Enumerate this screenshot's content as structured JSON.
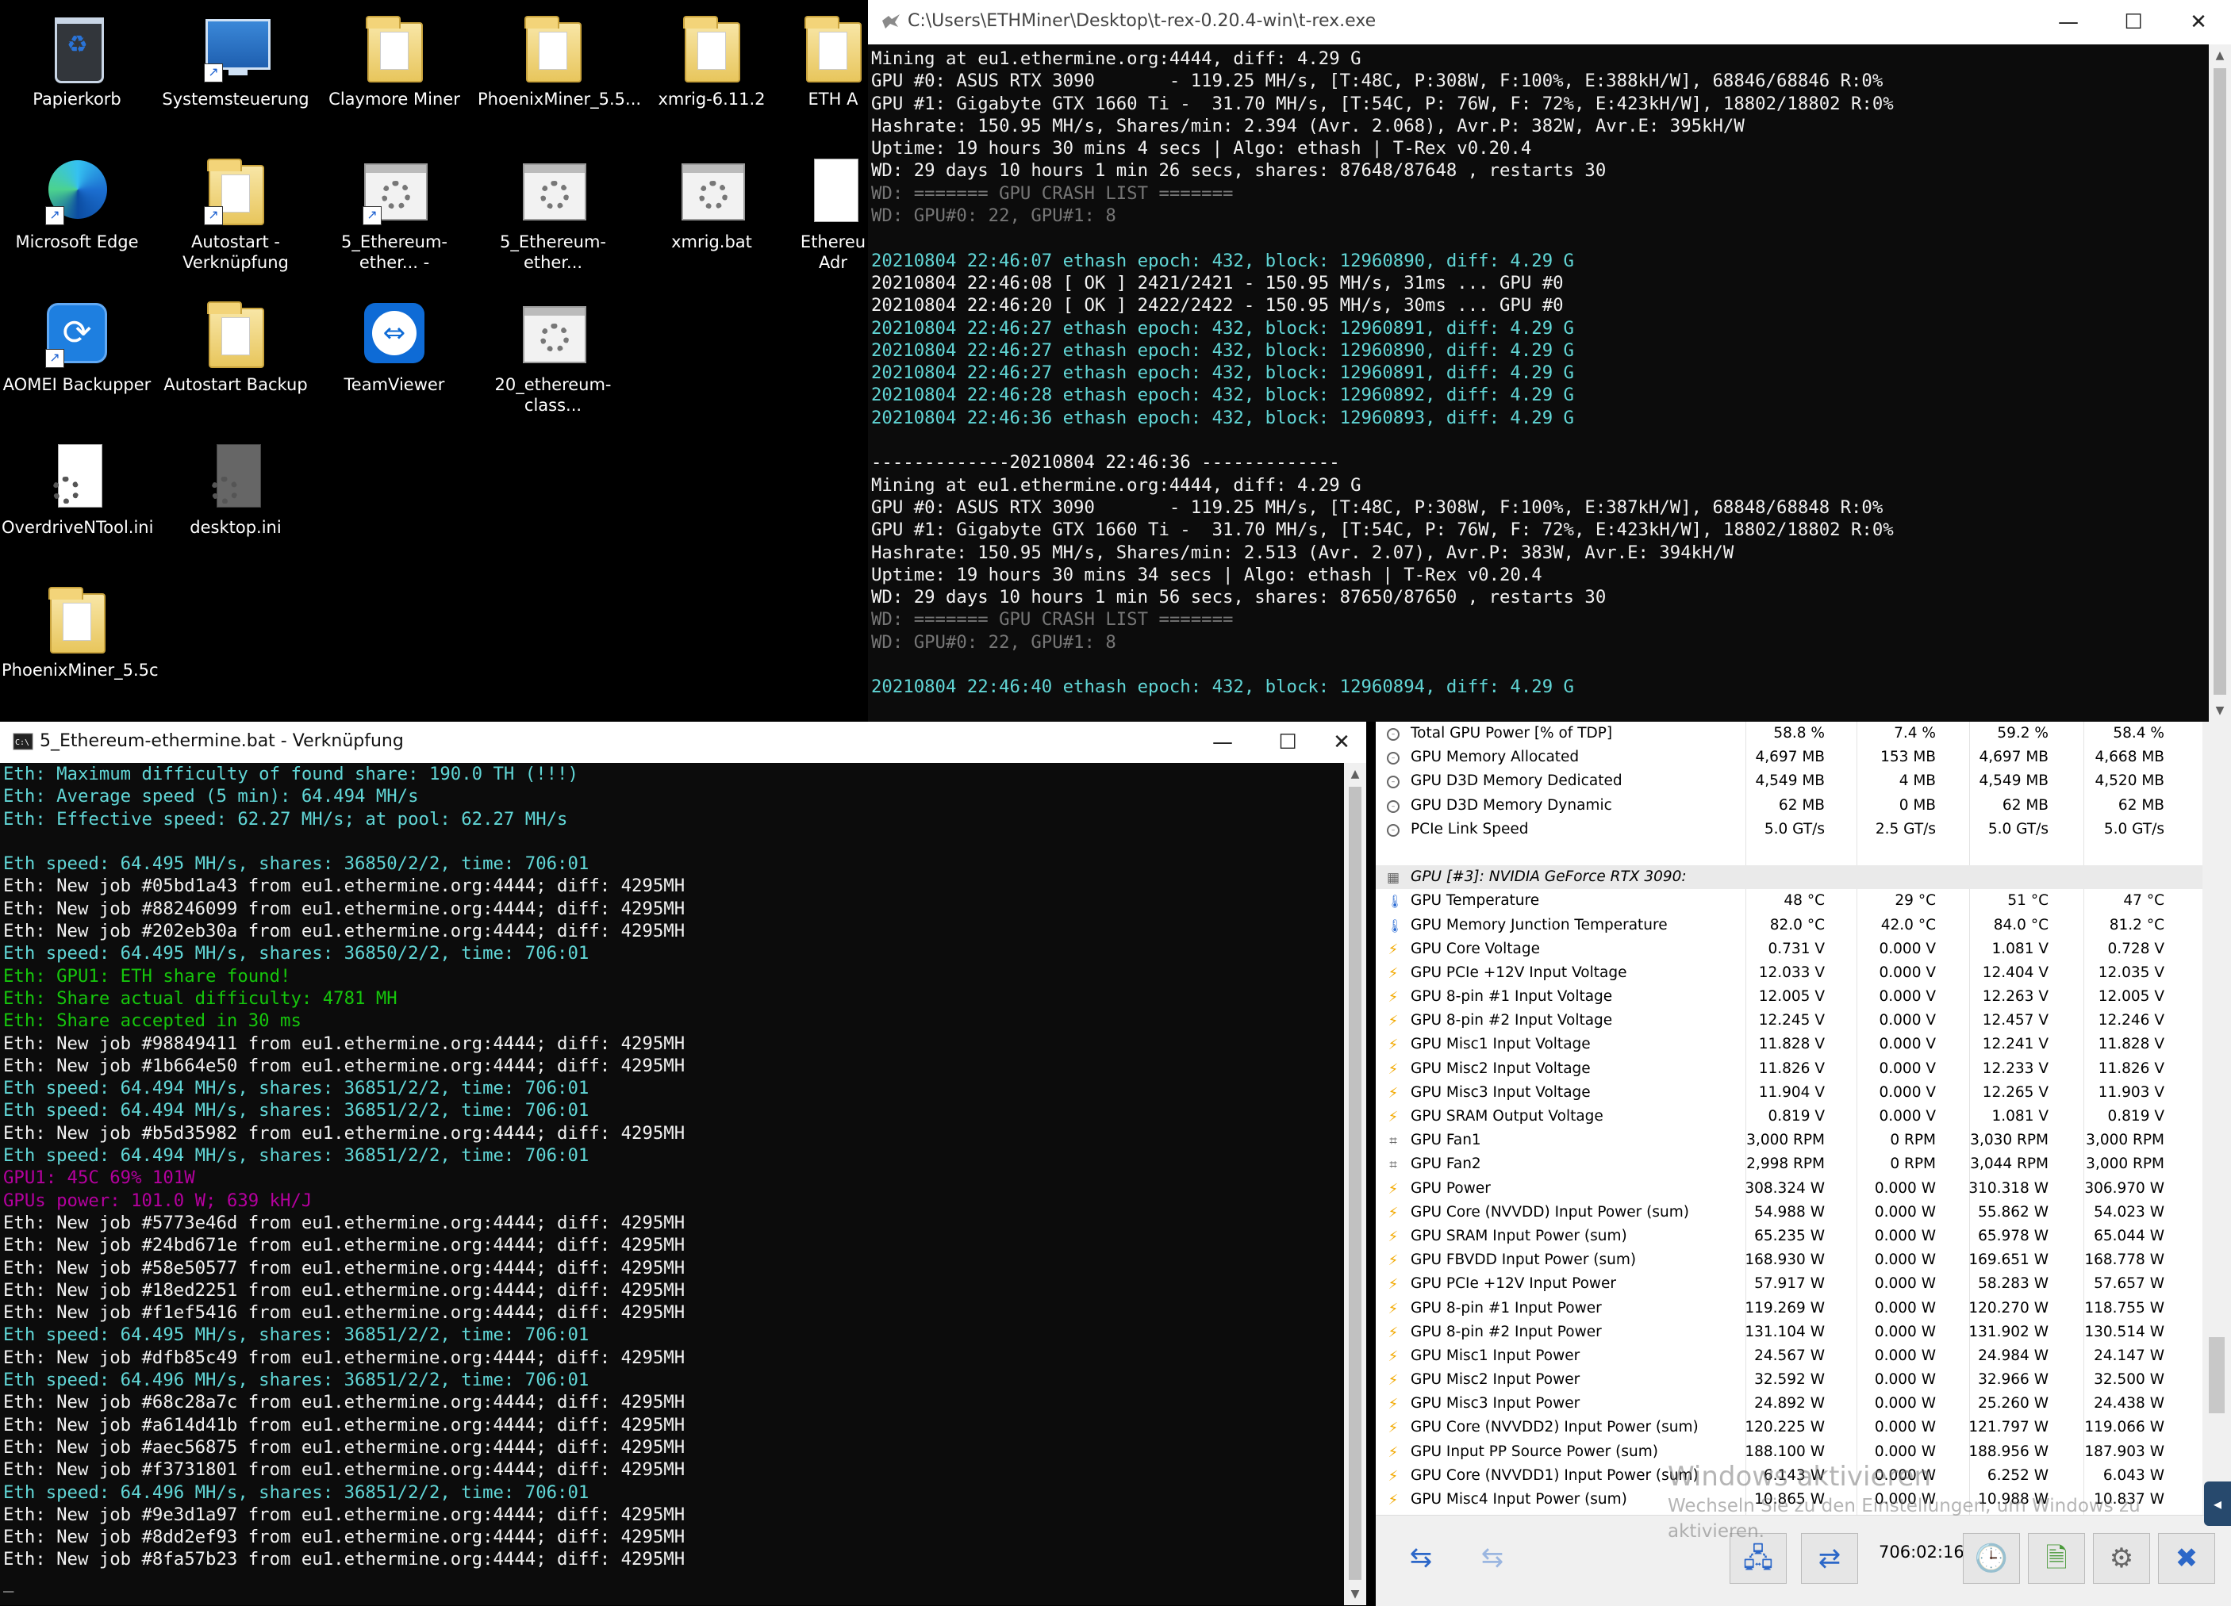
{
  "desktop": {
    "icons": [
      {
        "label": "Papierkorb",
        "icon": "recycle-bin-icon"
      },
      {
        "label": "Systemsteuerung",
        "icon": "control-panel-icon"
      },
      {
        "label": "Claymore Miner",
        "icon": "folder-icon"
      },
      {
        "label": "PhoenixMiner_5.5...",
        "icon": "folder-icon"
      },
      {
        "label": "xmrig-6.11.2",
        "icon": "folder-icon"
      },
      {
        "label": "ETH A",
        "icon": "folder-icon"
      },
      {
        "label": "Microsoft Edge",
        "icon": "edge-icon"
      },
      {
        "label": "Autostart - Verknüpfung",
        "icon": "folder-shortcut-icon"
      },
      {
        "label": "5_Ethereum-ether... -",
        "icon": "batch-file-icon"
      },
      {
        "label": "5_Ethereum-ether...",
        "icon": "batch-file-icon"
      },
      {
        "label": "xmrig.bat",
        "icon": "batch-file-icon"
      },
      {
        "label": "Ethereu Adr",
        "icon": "file-icon"
      },
      {
        "label": "AOMEI Backupper",
        "icon": "aomei-icon"
      },
      {
        "label": "Autostart Backup",
        "icon": "folder-icon"
      },
      {
        "label": "TeamViewer",
        "icon": "teamviewer-icon"
      },
      {
        "label": "20_ethereum-class...",
        "icon": "batch-file-icon"
      },
      {
        "label": "OverdriveNTool.ini",
        "icon": "ini-file-icon"
      },
      {
        "label": "desktop.ini",
        "icon": "ini-file-icon"
      },
      {
        "label": "PhoenixMiner_5.5c",
        "icon": "folder-icon"
      }
    ]
  },
  "trex_window": {
    "title": "C:\\Users\\ETHMiner\\Desktop\\t-rex-0.20.4-win\\t-rex.exe",
    "minimize": "—",
    "maximize": "☐",
    "close": "✕",
    "lines": [
      {
        "t": "Mining at eu1.ethermine.org:4444, diff: 4.29 G",
        "c": "white"
      },
      {
        "t": "GPU #0: ASUS RTX 3090       - 119.25 MH/s, [T:48C, P:308W, F:100%, E:388kH/W], 68846/68846 R:0%",
        "c": "white"
      },
      {
        "t": "GPU #1: Gigabyte GTX 1660 Ti -  31.70 MH/s, [T:54C, P: 76W, F: 72%, E:423kH/W], 18802/18802 R:0%",
        "c": "white"
      },
      {
        "t": "Hashrate: 150.95 MH/s, Shares/min: 2.394 (Avr. 2.068), Avr.P: 382W, Avr.E: 395kH/W",
        "c": "white"
      },
      {
        "t": "Uptime: 19 hours 30 mins 4 secs | Algo: ethash | T-Rex v0.20.4",
        "c": "white"
      },
      {
        "t": "WD: 29 days 10 hours 1 min 26 secs, shares: 87648/87648 , restarts 30",
        "c": "white"
      },
      {
        "t": "WD: ======= GPU CRASH LIST =======",
        "c": "gray"
      },
      {
        "t": "WD: GPU#0: 22, GPU#1: 8",
        "c": "gray"
      },
      {
        "t": "",
        "c": "white"
      },
      {
        "t": "20210804 22:46:07 ethash epoch: 432, block: 12960890, diff: 4.29 G",
        "c": "cyan"
      },
      {
        "t": "20210804 22:46:08 [ OK ] 2421/2421 - 150.95 MH/s, 31ms ... GPU #0",
        "c": "white"
      },
      {
        "t": "20210804 22:46:20 [ OK ] 2422/2422 - 150.95 MH/s, 30ms ... GPU #0",
        "c": "white"
      },
      {
        "t": "20210804 22:46:27 ethash epoch: 432, block: 12960891, diff: 4.29 G",
        "c": "cyan"
      },
      {
        "t": "20210804 22:46:27 ethash epoch: 432, block: 12960890, diff: 4.29 G",
        "c": "cyan"
      },
      {
        "t": "20210804 22:46:27 ethash epoch: 432, block: 12960891, diff: 4.29 G",
        "c": "cyan"
      },
      {
        "t": "20210804 22:46:28 ethash epoch: 432, block: 12960892, diff: 4.29 G",
        "c": "cyan"
      },
      {
        "t": "20210804 22:46:36 ethash epoch: 432, block: 12960893, diff: 4.29 G",
        "c": "cyan"
      },
      {
        "t": "",
        "c": "white"
      },
      {
        "t": "-------------20210804 22:46:36 -------------",
        "c": "white"
      },
      {
        "t": "Mining at eu1.ethermine.org:4444, diff: 4.29 G",
        "c": "white"
      },
      {
        "t": "GPU #0: ASUS RTX 3090       - 119.25 MH/s, [T:48C, P:308W, F:100%, E:387kH/W], 68848/68848 R:0%",
        "c": "white"
      },
      {
        "t": "GPU #1: Gigabyte GTX 1660 Ti -  31.70 MH/s, [T:54C, P: 76W, F: 72%, E:423kH/W], 18802/18802 R:0%",
        "c": "white"
      },
      {
        "t": "Hashrate: 150.95 MH/s, Shares/min: 2.513 (Avr. 2.07), Avr.P: 383W, Avr.E: 394kH/W",
        "c": "white"
      },
      {
        "t": "Uptime: 19 hours 30 mins 34 secs | Algo: ethash | T-Rex v0.20.4",
        "c": "white"
      },
      {
        "t": "WD: 29 days 10 hours 1 min 56 secs, shares: 87650/87650 , restarts 30",
        "c": "white"
      },
      {
        "t": "WD: ======= GPU CRASH LIST =======",
        "c": "gray"
      },
      {
        "t": "WD: GPU#0: 22, GPU#1: 8",
        "c": "gray"
      },
      {
        "t": "",
        "c": "white"
      },
      {
        "t": "20210804 22:46:40 ethash epoch: 432, block: 12960894, diff: 4.29 G",
        "c": "cyan"
      }
    ]
  },
  "claymore_window": {
    "title": "5_Ethereum-ethermine.bat - Verknüpfung",
    "minimize": "—",
    "maximize": "☐",
    "close": "✕",
    "cursor": "_",
    "lines": [
      {
        "t": "Eth: Maximum difficulty of found share: 190.0 TH (!!!)",
        "c": "cyan"
      },
      {
        "t": "Eth: Average speed (5 min): 64.494 MH/s",
        "c": "cyan"
      },
      {
        "t": "Eth: Effective speed: 62.27 MH/s; at pool: 62.27 MH/s",
        "c": "cyan"
      },
      {
        "t": "",
        "c": "white"
      },
      {
        "t": "Eth speed: 64.495 MH/s, shares: 36850/2/2, time: 706:01",
        "c": "cyan"
      },
      {
        "t": "Eth: New job #05bd1a43 from eu1.ethermine.org:4444; diff: 4295MH",
        "c": "white"
      },
      {
        "t": "Eth: New job #88246099 from eu1.ethermine.org:4444; diff: 4295MH",
        "c": "white"
      },
      {
        "t": "Eth: New job #202eb30a from eu1.ethermine.org:4444; diff: 4295MH",
        "c": "white"
      },
      {
        "t": "Eth speed: 64.495 MH/s, shares: 36850/2/2, time: 706:01",
        "c": "cyan"
      },
      {
        "t": "Eth: GPU1: ETH share found!",
        "c": "green"
      },
      {
        "t": "Eth: Share actual difficulty: 4781 MH",
        "c": "green"
      },
      {
        "t": "Eth: Share accepted in 30 ms",
        "c": "green"
      },
      {
        "t": "Eth: New job #98849411 from eu1.ethermine.org:4444; diff: 4295MH",
        "c": "white"
      },
      {
        "t": "Eth: New job #1b664e50 from eu1.ethermine.org:4444; diff: 4295MH",
        "c": "white"
      },
      {
        "t": "Eth speed: 64.494 MH/s, shares: 36851/2/2, time: 706:01",
        "c": "cyan"
      },
      {
        "t": "Eth speed: 64.494 MH/s, shares: 36851/2/2, time: 706:01",
        "c": "cyan"
      },
      {
        "t": "Eth: New job #b5d35982 from eu1.ethermine.org:4444; diff: 4295MH",
        "c": "white"
      },
      {
        "t": "Eth speed: 64.494 MH/s, shares: 36851/2/2, time: 706:01",
        "c": "cyan"
      },
      {
        "t": "GPU1: 45C 69% 101W",
        "c": "mag"
      },
      {
        "t": "GPUs power: 101.0 W; 639 kH/J",
        "c": "mag"
      },
      {
        "t": "Eth: New job #5773e46d from eu1.ethermine.org:4444; diff: 4295MH",
        "c": "white"
      },
      {
        "t": "Eth: New job #24bd671e from eu1.ethermine.org:4444; diff: 4295MH",
        "c": "white"
      },
      {
        "t": "Eth: New job #58e50577 from eu1.ethermine.org:4444; diff: 4295MH",
        "c": "white"
      },
      {
        "t": "Eth: New job #18ed2251 from eu1.ethermine.org:4444; diff: 4295MH",
        "c": "white"
      },
      {
        "t": "Eth: New job #f1ef5416 from eu1.ethermine.org:4444; diff: 4295MH",
        "c": "white"
      },
      {
        "t": "Eth speed: 64.495 MH/s, shares: 36851/2/2, time: 706:01",
        "c": "cyan"
      },
      {
        "t": "Eth: New job #dfb85c49 from eu1.ethermine.org:4444; diff: 4295MH",
        "c": "white"
      },
      {
        "t": "Eth speed: 64.496 MH/s, shares: 36851/2/2, time: 706:01",
        "c": "cyan"
      },
      {
        "t": "Eth: New job #68c28a7c from eu1.ethermine.org:4444; diff: 4295MH",
        "c": "white"
      },
      {
        "t": "Eth: New job #a614d41b from eu1.ethermine.org:4444; diff: 4295MH",
        "c": "white"
      },
      {
        "t": "Eth: New job #aec56875 from eu1.ethermine.org:4444; diff: 4295MH",
        "c": "white"
      },
      {
        "t": "Eth: New job #f3731801 from eu1.ethermine.org:4444; diff: 4295MH",
        "c": "white"
      },
      {
        "t": "Eth speed: 64.496 MH/s, shares: 36851/2/2, time: 706:01",
        "c": "cyan"
      },
      {
        "t": "Eth: New job #9e3d1a97 from eu1.ethermine.org:4444; diff: 4295MH",
        "c": "white"
      },
      {
        "t": "Eth: New job #8dd2ef93 from eu1.ethermine.org:4444; diff: 4295MH",
        "c": "white"
      },
      {
        "t": "Eth: New job #8fa57b23 from eu1.ethermine.org:4444; diff: 4295MH",
        "c": "white"
      }
    ]
  },
  "hwinfo": {
    "rows": [
      {
        "type": "sensor",
        "icon": "circle",
        "name": "Total GPU Power [% of TDP]",
        "vals": [
          "58.8 %",
          "7.4 %",
          "59.2 %",
          "58.4 %"
        ]
      },
      {
        "type": "sensor",
        "icon": "circle",
        "name": "GPU Memory Allocated",
        "vals": [
          "4,697 MB",
          "153 MB",
          "4,697 MB",
          "4,668 MB"
        ]
      },
      {
        "type": "sensor",
        "icon": "circle",
        "name": "GPU D3D Memory Dedicated",
        "vals": [
          "4,549 MB",
          "4 MB",
          "4,549 MB",
          "4,520 MB"
        ]
      },
      {
        "type": "sensor",
        "icon": "circle",
        "name": "GPU D3D Memory Dynamic",
        "vals": [
          "62 MB",
          "0 MB",
          "62 MB",
          "62 MB"
        ]
      },
      {
        "type": "sensor",
        "icon": "circle",
        "name": "PCIe Link Speed",
        "vals": [
          "5.0 GT/s",
          "2.5 GT/s",
          "5.0 GT/s",
          "5.0 GT/s"
        ]
      },
      {
        "type": "blank",
        "name": "",
        "vals": []
      },
      {
        "type": "head",
        "icon": "chip",
        "name": "GPU [#3]: NVIDIA GeForce RTX 3090:",
        "vals": []
      },
      {
        "type": "sensor",
        "icon": "therm",
        "name": "GPU Temperature",
        "vals": [
          "48 °C",
          "29 °C",
          "51 °C",
          "47 °C"
        ]
      },
      {
        "type": "sensor",
        "icon": "therm",
        "name": "GPU Memory Junction Temperature",
        "vals": [
          "82.0 °C",
          "42.0 °C",
          "84.0 °C",
          "81.2 °C"
        ]
      },
      {
        "type": "sensor",
        "icon": "bolt",
        "name": "GPU Core Voltage",
        "vals": [
          "0.731 V",
          "0.000 V",
          "1.081 V",
          "0.728 V"
        ]
      },
      {
        "type": "sensor",
        "icon": "bolt",
        "name": "GPU PCIe +12V Input Voltage",
        "vals": [
          "12.033 V",
          "0.000 V",
          "12.404 V",
          "12.035 V"
        ]
      },
      {
        "type": "sensor",
        "icon": "bolt",
        "name": "GPU 8-pin #1 Input Voltage",
        "vals": [
          "12.005 V",
          "0.000 V",
          "12.263 V",
          "12.005 V"
        ]
      },
      {
        "type": "sensor",
        "icon": "bolt",
        "name": "GPU 8-pin #2 Input Voltage",
        "vals": [
          "12.245 V",
          "0.000 V",
          "12.457 V",
          "12.246 V"
        ]
      },
      {
        "type": "sensor",
        "icon": "bolt",
        "name": "GPU Misc1 Input Voltage",
        "vals": [
          "11.828 V",
          "0.000 V",
          "12.241 V",
          "11.828 V"
        ]
      },
      {
        "type": "sensor",
        "icon": "bolt",
        "name": "GPU Misc2 Input Voltage",
        "vals": [
          "11.826 V",
          "0.000 V",
          "12.233 V",
          "11.826 V"
        ]
      },
      {
        "type": "sensor",
        "icon": "bolt",
        "name": "GPU Misc3 Input Voltage",
        "vals": [
          "11.904 V",
          "0.000 V",
          "12.265 V",
          "11.903 V"
        ]
      },
      {
        "type": "sensor",
        "icon": "bolt",
        "name": "GPU SRAM Output Voltage",
        "vals": [
          "0.819 V",
          "0.000 V",
          "1.081 V",
          "0.819 V"
        ]
      },
      {
        "type": "sensor",
        "icon": "fan",
        "name": "GPU Fan1",
        "vals": [
          "3,000 RPM",
          "0 RPM",
          "3,030 RPM",
          "3,000 RPM"
        ]
      },
      {
        "type": "sensor",
        "icon": "fan",
        "name": "GPU Fan2",
        "vals": [
          "2,998 RPM",
          "0 RPM",
          "3,044 RPM",
          "3,000 RPM"
        ]
      },
      {
        "type": "sensor",
        "icon": "bolt",
        "name": "GPU Power",
        "vals": [
          "308.324 W",
          "0.000 W",
          "310.318 W",
          "306.970 W"
        ]
      },
      {
        "type": "sensor",
        "icon": "bolt",
        "name": "GPU Core (NVVDD) Input Power (sum)",
        "vals": [
          "54.988 W",
          "0.000 W",
          "55.862 W",
          "54.023 W"
        ]
      },
      {
        "type": "sensor",
        "icon": "bolt",
        "name": "GPU SRAM Input Power (sum)",
        "vals": [
          "65.235 W",
          "0.000 W",
          "65.978 W",
          "65.044 W"
        ]
      },
      {
        "type": "sensor",
        "icon": "bolt",
        "name": "GPU FBVDD Input Power (sum)",
        "vals": [
          "168.930 W",
          "0.000 W",
          "169.651 W",
          "168.778 W"
        ]
      },
      {
        "type": "sensor",
        "icon": "bolt",
        "name": "GPU PCIe +12V Input Power",
        "vals": [
          "57.917 W",
          "0.000 W",
          "58.283 W",
          "57.657 W"
        ]
      },
      {
        "type": "sensor",
        "icon": "bolt",
        "name": "GPU 8-pin #1 Input Power",
        "vals": [
          "119.269 W",
          "0.000 W",
          "120.270 W",
          "118.755 W"
        ]
      },
      {
        "type": "sensor",
        "icon": "bolt",
        "name": "GPU 8-pin #2 Input Power",
        "vals": [
          "131.104 W",
          "0.000 W",
          "131.902 W",
          "130.514 W"
        ]
      },
      {
        "type": "sensor",
        "icon": "bolt",
        "name": "GPU Misc1 Input Power",
        "vals": [
          "24.567 W",
          "0.000 W",
          "24.984 W",
          "24.147 W"
        ]
      },
      {
        "type": "sensor",
        "icon": "bolt",
        "name": "GPU Misc2 Input Power",
        "vals": [
          "32.592 W",
          "0.000 W",
          "32.966 W",
          "32.500 W"
        ]
      },
      {
        "type": "sensor",
        "icon": "bolt",
        "name": "GPU Misc3 Input Power",
        "vals": [
          "24.892 W",
          "0.000 W",
          "25.260 W",
          "24.438 W"
        ]
      },
      {
        "type": "sensor",
        "icon": "bolt",
        "name": "GPU Core (NVVDD2) Input Power (sum)",
        "vals": [
          "120.225 W",
          "0.000 W",
          "121.797 W",
          "119.066 W"
        ]
      },
      {
        "type": "sensor",
        "icon": "bolt",
        "name": "GPU Input PP Source Power (sum)",
        "vals": [
          "188.100 W",
          "0.000 W",
          "188.956 W",
          "187.903 W"
        ]
      },
      {
        "type": "sensor",
        "icon": "bolt",
        "name": "GPU Core (NVVDD1) Input Power (sum)",
        "vals": [
          "6.143 W",
          "0.000 W",
          "6.252 W",
          "6.043 W"
        ]
      },
      {
        "type": "sensor",
        "icon": "bolt",
        "name": "GPU Misc4 Input Power (sum)",
        "vals": [
          "10.865 W",
          "0.000 W",
          "10.988 W",
          "10.837 W"
        ]
      }
    ],
    "timer": "706:02:16",
    "watermark_title": "Windows aktivieren",
    "watermark_sub": "Wechseln Sie zu den Einstellungen, um Windows zu",
    "watermark_sub2": "aktivieren."
  },
  "colors": {
    "console_bg": "#0c0c0c",
    "console_white": "#f2f2f2",
    "console_cyan": "#61d6d6",
    "console_green": "#16c60c",
    "console_magenta": "#b4009e",
    "console_gray": "#767676"
  }
}
